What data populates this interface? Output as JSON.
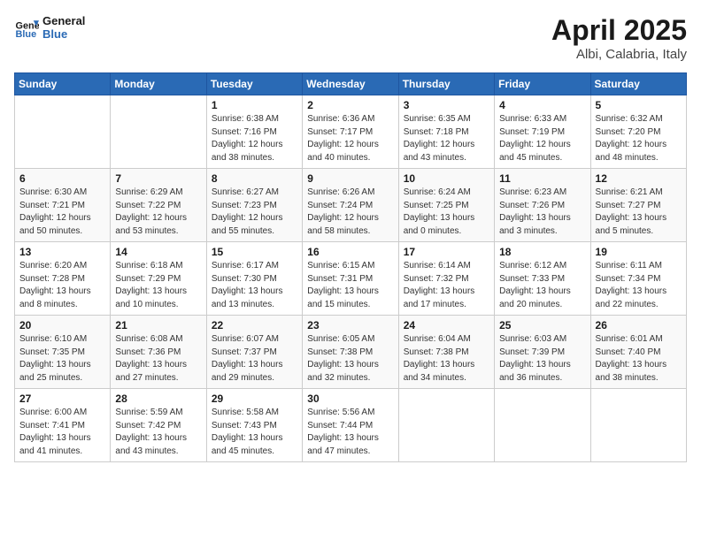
{
  "header": {
    "logo_general": "General",
    "logo_blue": "Blue",
    "month_title": "April 2025",
    "subtitle": "Albi, Calabria, Italy"
  },
  "weekdays": [
    "Sunday",
    "Monday",
    "Tuesday",
    "Wednesday",
    "Thursday",
    "Friday",
    "Saturday"
  ],
  "weeks": [
    [
      {
        "day": "",
        "detail": ""
      },
      {
        "day": "",
        "detail": ""
      },
      {
        "day": "1",
        "detail": "Sunrise: 6:38 AM\nSunset: 7:16 PM\nDaylight: 12 hours and 38 minutes."
      },
      {
        "day": "2",
        "detail": "Sunrise: 6:36 AM\nSunset: 7:17 PM\nDaylight: 12 hours and 40 minutes."
      },
      {
        "day": "3",
        "detail": "Sunrise: 6:35 AM\nSunset: 7:18 PM\nDaylight: 12 hours and 43 minutes."
      },
      {
        "day": "4",
        "detail": "Sunrise: 6:33 AM\nSunset: 7:19 PM\nDaylight: 12 hours and 45 minutes."
      },
      {
        "day": "5",
        "detail": "Sunrise: 6:32 AM\nSunset: 7:20 PM\nDaylight: 12 hours and 48 minutes."
      }
    ],
    [
      {
        "day": "6",
        "detail": "Sunrise: 6:30 AM\nSunset: 7:21 PM\nDaylight: 12 hours and 50 minutes."
      },
      {
        "day": "7",
        "detail": "Sunrise: 6:29 AM\nSunset: 7:22 PM\nDaylight: 12 hours and 53 minutes."
      },
      {
        "day": "8",
        "detail": "Sunrise: 6:27 AM\nSunset: 7:23 PM\nDaylight: 12 hours and 55 minutes."
      },
      {
        "day": "9",
        "detail": "Sunrise: 6:26 AM\nSunset: 7:24 PM\nDaylight: 12 hours and 58 minutes."
      },
      {
        "day": "10",
        "detail": "Sunrise: 6:24 AM\nSunset: 7:25 PM\nDaylight: 13 hours and 0 minutes."
      },
      {
        "day": "11",
        "detail": "Sunrise: 6:23 AM\nSunset: 7:26 PM\nDaylight: 13 hours and 3 minutes."
      },
      {
        "day": "12",
        "detail": "Sunrise: 6:21 AM\nSunset: 7:27 PM\nDaylight: 13 hours and 5 minutes."
      }
    ],
    [
      {
        "day": "13",
        "detail": "Sunrise: 6:20 AM\nSunset: 7:28 PM\nDaylight: 13 hours and 8 minutes."
      },
      {
        "day": "14",
        "detail": "Sunrise: 6:18 AM\nSunset: 7:29 PM\nDaylight: 13 hours and 10 minutes."
      },
      {
        "day": "15",
        "detail": "Sunrise: 6:17 AM\nSunset: 7:30 PM\nDaylight: 13 hours and 13 minutes."
      },
      {
        "day": "16",
        "detail": "Sunrise: 6:15 AM\nSunset: 7:31 PM\nDaylight: 13 hours and 15 minutes."
      },
      {
        "day": "17",
        "detail": "Sunrise: 6:14 AM\nSunset: 7:32 PM\nDaylight: 13 hours and 17 minutes."
      },
      {
        "day": "18",
        "detail": "Sunrise: 6:12 AM\nSunset: 7:33 PM\nDaylight: 13 hours and 20 minutes."
      },
      {
        "day": "19",
        "detail": "Sunrise: 6:11 AM\nSunset: 7:34 PM\nDaylight: 13 hours and 22 minutes."
      }
    ],
    [
      {
        "day": "20",
        "detail": "Sunrise: 6:10 AM\nSunset: 7:35 PM\nDaylight: 13 hours and 25 minutes."
      },
      {
        "day": "21",
        "detail": "Sunrise: 6:08 AM\nSunset: 7:36 PM\nDaylight: 13 hours and 27 minutes."
      },
      {
        "day": "22",
        "detail": "Sunrise: 6:07 AM\nSunset: 7:37 PM\nDaylight: 13 hours and 29 minutes."
      },
      {
        "day": "23",
        "detail": "Sunrise: 6:05 AM\nSunset: 7:38 PM\nDaylight: 13 hours and 32 minutes."
      },
      {
        "day": "24",
        "detail": "Sunrise: 6:04 AM\nSunset: 7:38 PM\nDaylight: 13 hours and 34 minutes."
      },
      {
        "day": "25",
        "detail": "Sunrise: 6:03 AM\nSunset: 7:39 PM\nDaylight: 13 hours and 36 minutes."
      },
      {
        "day": "26",
        "detail": "Sunrise: 6:01 AM\nSunset: 7:40 PM\nDaylight: 13 hours and 38 minutes."
      }
    ],
    [
      {
        "day": "27",
        "detail": "Sunrise: 6:00 AM\nSunset: 7:41 PM\nDaylight: 13 hours and 41 minutes."
      },
      {
        "day": "28",
        "detail": "Sunrise: 5:59 AM\nSunset: 7:42 PM\nDaylight: 13 hours and 43 minutes."
      },
      {
        "day": "29",
        "detail": "Sunrise: 5:58 AM\nSunset: 7:43 PM\nDaylight: 13 hours and 45 minutes."
      },
      {
        "day": "30",
        "detail": "Sunrise: 5:56 AM\nSunset: 7:44 PM\nDaylight: 13 hours and 47 minutes."
      },
      {
        "day": "",
        "detail": ""
      },
      {
        "day": "",
        "detail": ""
      },
      {
        "day": "",
        "detail": ""
      }
    ]
  ]
}
